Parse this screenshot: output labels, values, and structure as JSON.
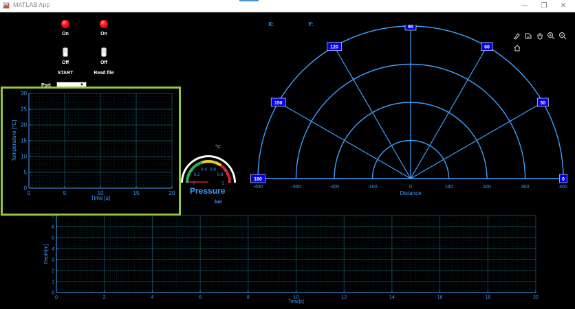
{
  "window": {
    "title": "MATLAB App",
    "controls": {
      "minimize": "—",
      "restore": "❐",
      "close": "✕"
    }
  },
  "lamps": [
    {
      "label": "On",
      "color": "#ff1a1a"
    },
    {
      "label": "On",
      "color": "#ff1a1a"
    }
  ],
  "switches": [
    {
      "state": "Off",
      "label": "START"
    },
    {
      "state": "Off",
      "label": "Read file"
    }
  ],
  "port": {
    "label": "Port",
    "value": ""
  },
  "cursor": {
    "x_label": "X:",
    "y_label": "Y:"
  },
  "gauge": {
    "title": "Pressure",
    "unit": "bar",
    "unit_top": "°C",
    "ticks": [
      "0",
      "0.2",
      "0.4",
      "0.6",
      "0.8",
      "1"
    ],
    "value": 0
  },
  "accent_color": "#3fa0ff",
  "highlight_color": "#96c83c",
  "chart_data": [
    {
      "type": "line",
      "name": "temperature-plot",
      "xlabel": "Time [s]",
      "ylabel": "Temperature [°C]",
      "xlim": [
        0,
        20
      ],
      "ylim": [
        0,
        30
      ],
      "xticks": [
        0,
        5,
        10,
        15,
        20
      ],
      "yticks": [
        0,
        5,
        10,
        15,
        20,
        25,
        30
      ],
      "grid": true,
      "series": []
    },
    {
      "type": "polar",
      "name": "distance-polar",
      "xlabel": "Distance",
      "rlim": [
        -400,
        400
      ],
      "rticks": [
        -400,
        -300,
        -200,
        -100,
        0,
        100,
        200,
        300,
        400
      ],
      "angle_ticks": [
        0,
        30,
        60,
        90,
        120,
        150,
        180
      ],
      "grid": true,
      "series": []
    },
    {
      "type": "line",
      "name": "depth-plot",
      "xlabel": "Time[s]",
      "ylabel": "Depth[m]",
      "xlim": [
        0,
        20
      ],
      "ylim": [
        0,
        7
      ],
      "xticks": [
        0,
        2,
        4,
        6,
        8,
        10,
        12,
        14,
        16,
        18,
        20
      ],
      "yticks": [
        0,
        1,
        2,
        3,
        4,
        5,
        6,
        7
      ],
      "grid": true,
      "series": []
    }
  ]
}
